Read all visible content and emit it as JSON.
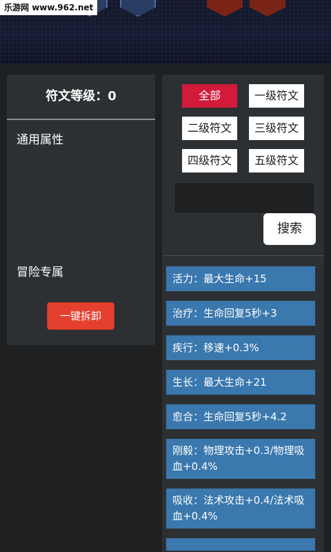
{
  "watermark": {
    "site": "乐游网",
    "domain": "www.962.net"
  },
  "left_panel": {
    "rune_level": "符文等级：0",
    "common_attr_title": "通用属性",
    "adventure_title": "冒险专属",
    "disassemble_label": "一键拆卸"
  },
  "filters": [
    {
      "label": "全部",
      "selected": true
    },
    {
      "label": "一级符文",
      "selected": false
    },
    {
      "label": "二级符文",
      "selected": false
    },
    {
      "label": "三级符文",
      "selected": false
    },
    {
      "label": "四级符文",
      "selected": false
    },
    {
      "label": "五级符文",
      "selected": false
    }
  ],
  "search": {
    "value": "",
    "button_label": "搜索"
  },
  "runes": [
    {
      "text": "活力：最大生命+15"
    },
    {
      "text": "治疗：生命回复5秒+3"
    },
    {
      "text": "疾行：移速+0.3%"
    },
    {
      "text": "生长：最大生命+21"
    },
    {
      "text": "愈合：生命回复5秒+4.2"
    },
    {
      "text": "刚毅：物理攻击+0.3/物理吸血+0.4%"
    },
    {
      "text": "吸收：法术攻击+0.4/法术吸血+0.4%"
    }
  ],
  "colors": {
    "background": "#1e2022",
    "panel": "#2d3033",
    "accent_red": "#d21a3a",
    "button_red": "#e5402f",
    "rune_blue": "#3a78ae"
  }
}
